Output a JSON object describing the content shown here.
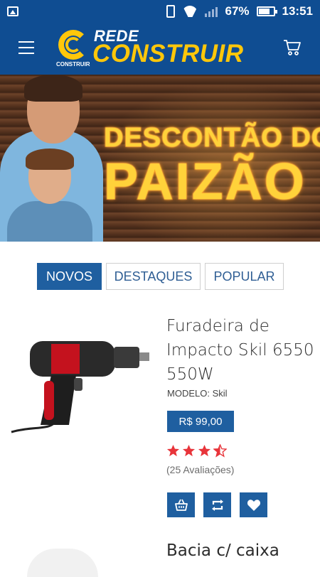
{
  "status_bar": {
    "battery": "67%",
    "time": "13:51"
  },
  "header": {
    "logo_top": "REDE",
    "logo_main": "CONSTRUIR",
    "logo_mark_caption": "CONSTRUIR",
    "menu_icon": "hamburger-menu-icon",
    "cart_icon": "shopping-cart-icon"
  },
  "banner": {
    "line1": "DESCONTÃO DO",
    "line2": "PAIZÃO"
  },
  "tabs": [
    {
      "label": "NOVOS",
      "active": true
    },
    {
      "label": "DESTAQUES",
      "active": false
    },
    {
      "label": "POPULAR",
      "active": false
    }
  ],
  "products": [
    {
      "title": "Furadeira de Impacto Skil 6550 550W",
      "model": "MODELO: Skil",
      "price": "R$ 99,00",
      "rating": 3.5,
      "reviews": "(25 Avaliações)",
      "actions": [
        "basket-icon",
        "compare-icon",
        "heart-icon"
      ]
    },
    {
      "title": "Bacia c/ caixa"
    }
  ],
  "colors": {
    "primary": "#0f4d92",
    "accent": "#ffc70a",
    "button": "#1f5fa0",
    "star": "#e8343a"
  }
}
